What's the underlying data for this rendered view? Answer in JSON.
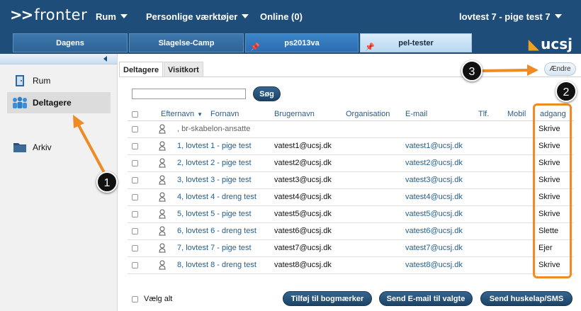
{
  "header": {
    "logo_arrows": ">>",
    "logo_text": "fronter",
    "menu": [
      {
        "label": "Rum"
      },
      {
        "label": "Personlige værktøjer"
      },
      {
        "label": "Online (0)"
      }
    ],
    "user": "lovtest 7 - pige test 7",
    "brand": "ucsj"
  },
  "tabs": [
    {
      "label": "Dagens"
    },
    {
      "label": "Slagelse-Camp"
    },
    {
      "label": "ps2013va",
      "pinned": true
    },
    {
      "label": "pel-tester",
      "pinned": true
    }
  ],
  "sidebar": {
    "items": [
      {
        "label": "Rum",
        "icon": "door-icon"
      },
      {
        "label": "Deltagere",
        "icon": "people-icon"
      },
      {
        "label": "Arkiv",
        "icon": "folder-icon"
      }
    ]
  },
  "content_tabs": [
    {
      "label": "Deltagere"
    },
    {
      "label": "Visitkort"
    }
  ],
  "aendre_label": "Ændre",
  "search": {
    "value": "",
    "button": "Søg"
  },
  "columns": [
    "Efternavn",
    "Fornavn",
    "Brugernavn",
    "Organisation",
    "E-mail",
    "Tlf.",
    "Mobil",
    "adgang"
  ],
  "rows": [
    {
      "name": ", br-skabelon-ansatte",
      "username": "",
      "email": "",
      "access": "Skrive",
      "muted": true
    },
    {
      "name": "1, lovtest 1 - pige test",
      "username": "vatest1@ucsj.dk",
      "email": "vatest1@ucsj.dk",
      "access": "Skrive"
    },
    {
      "name": "2, lovtest 2 - pige test",
      "username": "vatest2@ucsj.dk",
      "email": "vatest2@ucsj.dk",
      "access": "Skrive"
    },
    {
      "name": "3, lovtest 3 - pige test",
      "username": "vatest3@ucsj.dk",
      "email": "vatest3@ucsj.dk",
      "access": "Skrive"
    },
    {
      "name": "4, lovtest 4 - dreng test",
      "username": "vatest4@ucsj.dk",
      "email": "vatest4@ucsj.dk",
      "access": "Skrive"
    },
    {
      "name": "5, lovtest 5 - pige test",
      "username": "vatest5@ucsj.dk",
      "email": "vatest5@ucsj.dk",
      "access": "Skrive"
    },
    {
      "name": "6, lovtest 6 - dreng test",
      "username": "vatest6@ucsj.dk",
      "email": "vatest6@ucsj.dk",
      "access": "Slette"
    },
    {
      "name": "7, lovtest 7 - pige test",
      "username": "vatest7@ucsj.dk",
      "email": "vatest7@ucsj.dk",
      "access": "Ejer"
    },
    {
      "name": "8, lovtest 8 - dreng test",
      "username": "vatest8@ucsj.dk",
      "email": "vatest8@ucsj.dk",
      "access": "Skrive"
    }
  ],
  "footer": {
    "select_all": "Vælg alt",
    "buttons": [
      "Tilføj til bogmærker",
      "Send E-mail til valgte",
      "Send huskelap/SMS"
    ]
  },
  "annotations": {
    "badges": [
      "1",
      "2",
      "3"
    ],
    "color": "#f08a24"
  }
}
